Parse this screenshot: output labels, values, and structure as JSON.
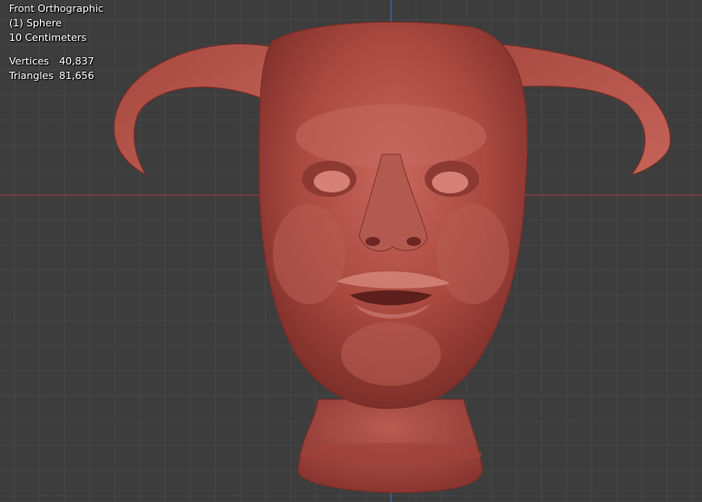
{
  "viewport": {
    "view_name": "Front Orthographic",
    "object_name": "(1) Sphere",
    "grid_scale": "10 Centimeters",
    "stats": [
      {
        "label": "Vertices",
        "value": "40,837"
      },
      {
        "label": "Triangles",
        "value": "81,656"
      }
    ],
    "colors": {
      "background": "#3d3d3d",
      "grid_minor": "#464646",
      "grid_major": "#525252",
      "x_axis": "#8a3b47",
      "z_axis": "#3b5f99",
      "mesh": "#b0524a"
    }
  }
}
